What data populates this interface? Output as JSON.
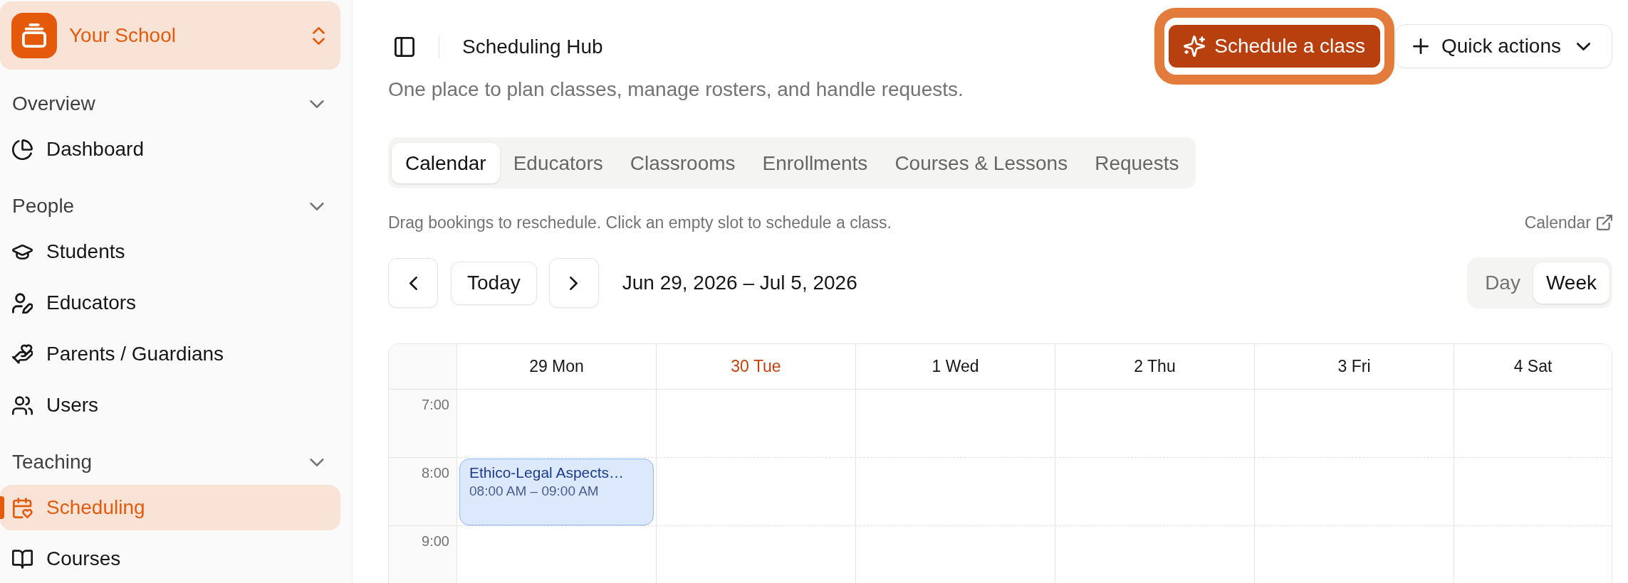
{
  "sidebar": {
    "workspace": {
      "name": "Your School"
    },
    "sections": [
      {
        "title": "Overview",
        "expanded": true,
        "items": [
          {
            "label": "Dashboard",
            "selected": false
          }
        ]
      },
      {
        "title": "People",
        "expanded": true,
        "items": [
          {
            "label": "Students",
            "selected": false
          },
          {
            "label": "Educators",
            "selected": false
          },
          {
            "label": "Parents / Guardians",
            "selected": false
          },
          {
            "label": "Users",
            "selected": false
          }
        ]
      },
      {
        "title": "Teaching",
        "expanded": true,
        "items": [
          {
            "label": "Scheduling",
            "selected": true
          },
          {
            "label": "Courses",
            "selected": false
          }
        ]
      }
    ]
  },
  "header": {
    "title": "Scheduling Hub",
    "subtitle": "One place to plan classes, manage rosters, and handle requests.",
    "primary_action": {
      "label": "Schedule a class",
      "highlighted": true
    },
    "secondary_action": {
      "label": "Quick actions"
    }
  },
  "tabs": [
    {
      "label": "Calendar",
      "selected": true
    },
    {
      "label": "Educators",
      "selected": false
    },
    {
      "label": "Classrooms",
      "selected": false
    },
    {
      "label": "Enrollments",
      "selected": false
    },
    {
      "label": "Courses & Lessons",
      "selected": false
    },
    {
      "label": "Requests",
      "selected": false
    }
  ],
  "calendar": {
    "hint": "Drag bookings to reschedule. Click an empty slot to schedule a class.",
    "external_link": "Calendar",
    "today_button": "Today",
    "date_range": "Jun 29, 2026 – Jul 5, 2026",
    "views": [
      {
        "label": "Day",
        "selected": false
      },
      {
        "label": "Week",
        "selected": true
      }
    ],
    "days": [
      {
        "label": "29 Mon",
        "today": false
      },
      {
        "label": "30 Tue",
        "today": true
      },
      {
        "label": "1 Wed",
        "today": false
      },
      {
        "label": "2 Thu",
        "today": false
      },
      {
        "label": "3 Fri",
        "today": false
      },
      {
        "label": "4 Sat",
        "today": false
      }
    ],
    "rows": [
      {
        "time": "7:00"
      },
      {
        "time": "8:00",
        "cells": [
          {
            "booking": {
              "title": "Ethico-Legal Aspects…",
              "time": "08:00 AM – 09:00 AM"
            }
          }
        ]
      },
      {
        "time": "9:00"
      }
    ]
  }
}
